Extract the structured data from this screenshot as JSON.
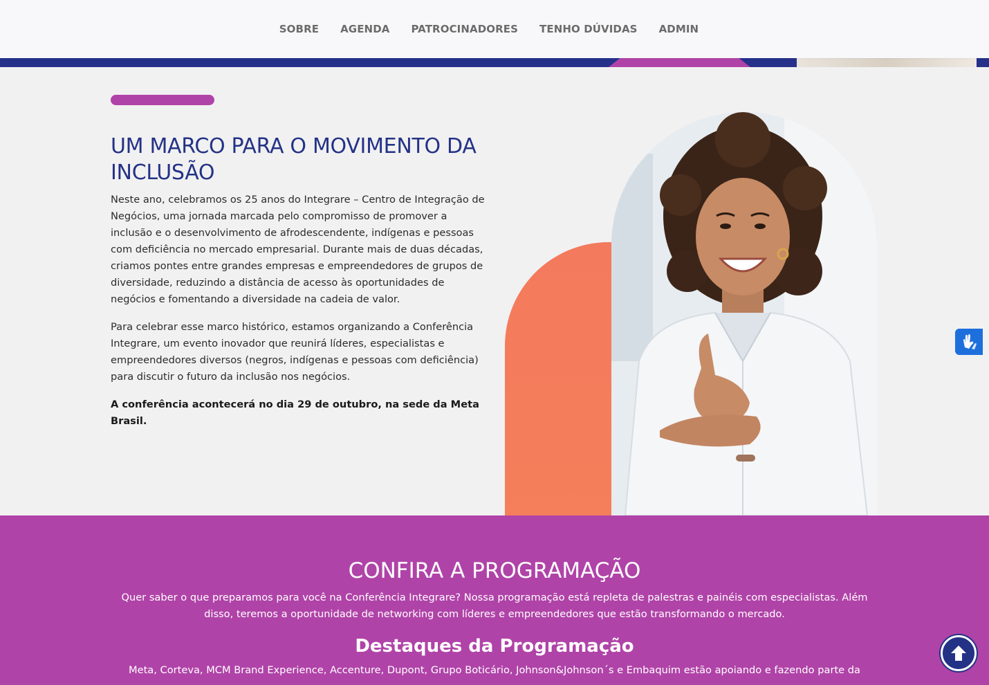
{
  "nav": {
    "items": [
      {
        "label": "SOBRE"
      },
      {
        "label": "AGENDA"
      },
      {
        "label": "PATROCINADORES"
      },
      {
        "label": "TENHO DÚVIDAS"
      },
      {
        "label": "ADMIN"
      }
    ]
  },
  "about": {
    "title": "UM MARCO PARA O MOVIMENTO DA INCLUSÃO",
    "paragraph1": "Neste ano, celebramos os 25 anos do Integrare – Centro de Integração de Negócios, uma jornada marcada pelo compromisso de promover a inclusão e o desenvolvimento de afrodescendente, indígenas e pessoas com deficiência no mercado empresarial. Durante mais de duas décadas, criamos pontes entre grandes empresas e empreendedores de grupos de diversidade, reduzindo a distância de acesso às oportunidades de negócios e fomentando a diversidade na cadeia de valor.",
    "paragraph2": "Para celebrar esse marco histórico, estamos organizando a Conferência Integrare, um evento inovador que reunirá líderes, especialistas e empreendedores diversos (negros, indígenas e pessoas com deficiência) para discutir o futuro da inclusão nos negócios.",
    "highlight": "A conferência acontecerá no dia 29 de outubro, na sede da Meta Brasil."
  },
  "program": {
    "title": "CONFIRA A PROGRAMAÇÃO",
    "description": "Quer saber o que preparamos para você na Conferência Integrare? Nossa programação está repleta de palestras e painéis com especialistas. Além disso, teremos a oportunidade de networking com líderes e empreendedores que estão transformando o mercado.",
    "subtitle": "Destaques da Programação",
    "sponsors_text": "Meta, Corteva, MCM Brand Experience, Accenture, Dupont, Grupo Boticário, Johnson&Johnson´s e Embaquim estão apoiando e fazendo parte da"
  },
  "colors": {
    "brand_navy": "#243286",
    "brand_magenta": "#b043a8",
    "accent_orange": "#f47a5d",
    "vlibras_blue": "#1d6fdc"
  },
  "icons": {
    "vlibras": "sign-language-hands-icon",
    "scroll_top": "arrow-up-icon"
  }
}
